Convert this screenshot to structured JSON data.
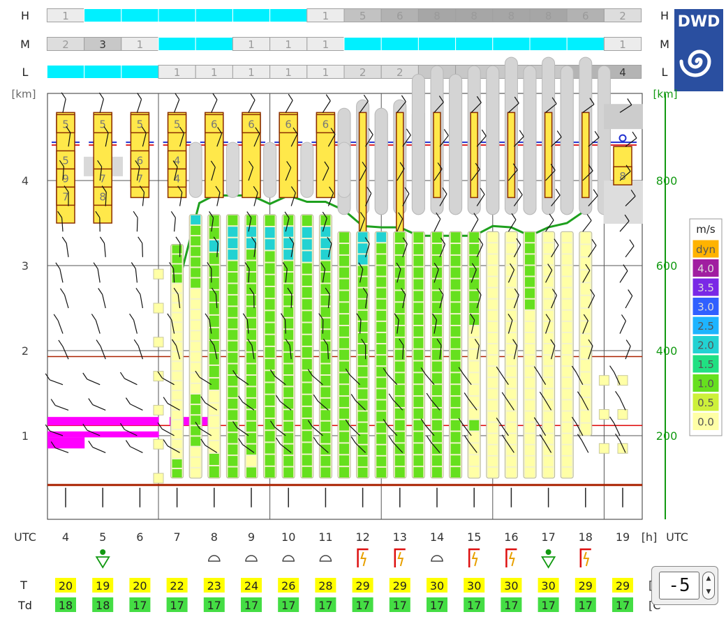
{
  "chart_data": {
    "type": "meteogram",
    "time_axis": {
      "label": "UTC",
      "unit": "[h]",
      "right_label": "UTC",
      "hours": [
        4,
        5,
        6,
        7,
        8,
        9,
        10,
        11,
        12,
        13,
        14,
        15,
        16,
        17,
        18,
        19
      ]
    },
    "left_axis": {
      "unit": "[km]",
      "ticks": [
        1,
        2,
        3,
        4
      ],
      "range": [
        0.35,
        4.95
      ]
    },
    "right_axis": {
      "unit": "[km]",
      "ticks": [
        200,
        400,
        600,
        800
      ],
      "range": [
        70,
        990
      ],
      "color": "#119911"
    },
    "cloud_layers": [
      {
        "label": "H",
        "cells": [
          {
            "hours": [
              4
            ],
            "val": "1"
          },
          {
            "hours": [
              5,
              6,
              7,
              8,
              9,
              10
            ],
            "val": "cyan"
          },
          {
            "hours": [
              11
            ],
            "val": "1"
          },
          {
            "hours": [
              12
            ],
            "val": "5"
          },
          {
            "hours": [
              13
            ],
            "val": "6"
          },
          {
            "hours": [
              14
            ],
            "val": "8"
          },
          {
            "hours": [
              15
            ],
            "val": "8"
          },
          {
            "hours": [
              16
            ],
            "val": "8"
          },
          {
            "hours": [
              17
            ],
            "val": "8"
          },
          {
            "hours": [
              18
            ],
            "val": "6"
          },
          {
            "hours": [
              19
            ],
            "val": "2"
          }
        ]
      },
      {
        "label": "M",
        "cells": [
          {
            "hours": [
              4
            ],
            "val": "2"
          },
          {
            "hours": [
              5
            ],
            "val": "3"
          },
          {
            "hours": [
              6
            ],
            "val": "1"
          },
          {
            "hours": [
              7,
              8
            ],
            "val": "cyan"
          },
          {
            "hours": [
              9
            ],
            "val": "1"
          },
          {
            "hours": [
              10
            ],
            "val": "1"
          },
          {
            "hours": [
              11
            ],
            "val": "1"
          },
          {
            "hours": [
              12,
              13,
              14,
              15,
              16,
              17,
              18
            ],
            "val": "cyan"
          },
          {
            "hours": [
              19
            ],
            "val": "1"
          }
        ]
      },
      {
        "label": "L",
        "cells": [
          {
            "hours": [
              4,
              5,
              6
            ],
            "val": "cyan"
          },
          {
            "hours": [
              7
            ],
            "val": "1"
          },
          {
            "hours": [
              8
            ],
            "val": "1"
          },
          {
            "hours": [
              9
            ],
            "val": "1"
          },
          {
            "hours": [
              10
            ],
            "val": "1"
          },
          {
            "hours": [
              11
            ],
            "val": "1"
          },
          {
            "hours": [
              12
            ],
            "val": "2"
          },
          {
            "hours": [
              13
            ],
            "val": "2"
          },
          {
            "hours": [
              14
            ],
            "val": "3"
          },
          {
            "hours": [
              15
            ],
            "val": "3"
          },
          {
            "hours": [
              16
            ],
            "val": "3"
          },
          {
            "hours": [
              17
            ],
            "val": "3"
          },
          {
            "hours": [
              18
            ],
            "val": "4"
          },
          {
            "hours": [
              19
            ],
            "val": "4"
          }
        ]
      }
    ],
    "layer_colors": {
      "cyan": "#00f0ff",
      "1": "#ececec",
      "2": "#dddddd",
      "3": "#c8c8c8",
      "4": "#b4b4b4",
      "5": "#c2c2c2",
      "6": "#b2b2b2",
      "8": "#a6a6a6",
      "text_light": "#9a9a9a",
      "text_dark": "#333333"
    },
    "logo_text": "DWD",
    "logo_color": "#2a4fa0",
    "series": [
      {
        "name": "boundary_layer_height",
        "unit": "m",
        "x": [
          7,
          7.6,
          8,
          8.5,
          9,
          9.5,
          10,
          10.5,
          11,
          11.5,
          12,
          12.5,
          13,
          13.5,
          14,
          14.5,
          15,
          15.5,
          16,
          16.5,
          17,
          17.5,
          18
        ],
        "values": [
          543,
          747,
          765,
          765,
          765,
          745,
          765,
          750,
          750,
          730,
          693,
          690,
          690,
          670,
          670,
          670,
          670,
          693,
          690,
          670,
          690,
          700,
          730
        ]
      }
    ],
    "temperature_label": "T",
    "temperature": [
      20,
      19,
      20,
      22,
      23,
      24,
      26,
      28,
      29,
      29,
      30,
      30,
      30,
      30,
      29,
      29
    ],
    "dewpoint_label": "Td",
    "dewpoint": [
      18,
      18,
      17,
      17,
      17,
      17,
      17,
      17,
      17,
      17,
      17,
      17,
      17,
      17,
      17,
      17
    ],
    "temp_unit_partial": "[C",
    "weather_symbols": [
      "",
      "drizzle-shower",
      "",
      "",
      "cloud",
      "cloud",
      "cloud",
      "cloud",
      "thunderstorm",
      "thunderstorm",
      "cloud",
      "thunderstorm",
      "thunderstorm",
      "drizzle-shower",
      "thunderstorm",
      ""
    ],
    "updraft_legend": {
      "title": "m/s",
      "entries": [
        {
          "label": "dyn",
          "color": "#ffb300"
        },
        {
          "label": "4.0",
          "color": "#a01ea0"
        },
        {
          "label": "3.5",
          "color": "#7a28e6"
        },
        {
          "label": "3.0",
          "color": "#3060ff"
        },
        {
          "label": "2.5",
          "color": "#1eb4ff"
        },
        {
          "label": "2.0",
          "color": "#22d2d2"
        },
        {
          "label": "1.5",
          "color": "#20e082"
        },
        {
          "label": "1.0",
          "color": "#66e01e"
        },
        {
          "label": "0.5",
          "color": "#cdf03a"
        },
        {
          "label": "0.0",
          "color": "#ffffa6"
        }
      ]
    },
    "updraft_columns": [
      {
        "hour": 6.5,
        "top": 3.1,
        "bottom": 0.5,
        "cells": "p",
        "sparse": true
      },
      {
        "hour": 7,
        "top": 3.25,
        "bottom": 0.5,
        "cells": "ggggppppppppppppppppppgg"
      },
      {
        "hour": 7.5,
        "top": 3.6,
        "bottom": 0.5,
        "cells": "cggggggppppppppppgggggppp"
      },
      {
        "hour": 8,
        "top": 3.6,
        "bottom": 0.5,
        "cells": "ggcgggggggggggpppppgg"
      },
      {
        "hour": 8.5,
        "top": 3.6,
        "bottom": 0.5,
        "cells": "gcccggggggggggggggggggg"
      },
      {
        "hour": 9,
        "top": 3.6,
        "bottom": 0.5,
        "cells": "gccggggggggggggggggggpg"
      },
      {
        "hour": 9.5,
        "top": 3.6,
        "bottom": 0.5,
        "cells": "gccggggggggggggggggggg"
      },
      {
        "hour": 10,
        "top": 3.6,
        "bottom": 0.5,
        "cells": "gcccggggggggggggggggggg"
      },
      {
        "hour": 10.5,
        "top": 3.6,
        "bottom": 0.5,
        "cells": "gcccgggggggggggggggggg"
      },
      {
        "hour": 11,
        "top": 3.6,
        "bottom": 0.5,
        "cells": "gcccggggggggggggggggggg"
      },
      {
        "hour": 11.5,
        "top": 3.4,
        "bottom": 0.5,
        "cells": "ggggggggggggggggggggg"
      },
      {
        "hour": 12,
        "top": 3.4,
        "bottom": 0.5,
        "cells": "cccggggggggggggggggggg"
      },
      {
        "hour": 12.5,
        "top": 3.4,
        "bottom": 0.5,
        "cells": "cggggggggggggggggggggg"
      },
      {
        "hour": 13,
        "top": 3.4,
        "bottom": 0.5,
        "cells": "ggggggggggggggggggggg"
      },
      {
        "hour": 13.5,
        "top": 3.4,
        "bottom": 0.5,
        "cells": "ggggggggggggggggggggg"
      },
      {
        "hour": 14,
        "top": 3.4,
        "bottom": 0.5,
        "cells": "ggggggggggggggggggggg"
      },
      {
        "hour": 14.5,
        "top": 3.4,
        "bottom": 0.5,
        "cells": "ggggggggggggggggggggg"
      },
      {
        "hour": 15,
        "top": 3.4,
        "bottom": 0.5,
        "cells": "ggggggggppppppppgpppp"
      },
      {
        "hour": 15.5,
        "top": 3.4,
        "bottom": 0.5,
        "cells": "pppppppppppppppppppppp"
      },
      {
        "hour": 16,
        "top": 3.4,
        "bottom": 0.5,
        "cells": "pppppppppppppppppppppp"
      },
      {
        "hour": 16.5,
        "top": 3.4,
        "bottom": 0.5,
        "cells": "gggggggppppppppppppppp"
      },
      {
        "hour": 17,
        "top": 3.4,
        "bottom": 0.5,
        "cells": "pppppppppppppppppppppp"
      },
      {
        "hour": 17.5,
        "top": 3.4,
        "bottom": 0.5,
        "cells": "pppppppppppppppppppppp"
      },
      {
        "hour": 18,
        "top": 3.4,
        "bottom": 1.0,
        "cells": "pppppppppppppppp"
      },
      {
        "hour": 18.5,
        "top": 2.05,
        "bottom": 0.85,
        "cells": "p",
        "sparse": true
      },
      {
        "hour": 19,
        "top": 2.05,
        "bottom": 0.85,
        "cells": "p",
        "sparse": true
      }
    ],
    "cloud_boxes": [
      {
        "hour": 4,
        "top": 4.8,
        "bottom": 3.5,
        "labels": [
          "5",
          "",
          "5",
          "9",
          "7"
        ]
      },
      {
        "hour": 5,
        "top": 4.8,
        "bottom": 3.5,
        "labels": [
          "5",
          "",
          "",
          "7",
          "8"
        ]
      },
      {
        "hour": 6,
        "top": 4.8,
        "bottom": 3.8,
        "labels": [
          "5",
          "",
          "6",
          "7"
        ]
      },
      {
        "hour": 7,
        "top": 4.8,
        "bottom": 3.8,
        "labels": [
          "5",
          "",
          "4",
          "4"
        ]
      },
      {
        "hour": 8,
        "top": 4.8,
        "bottom": 3.8,
        "labels": [
          "6"
        ]
      },
      {
        "hour": 9,
        "top": 4.8,
        "bottom": 3.8,
        "labels": [
          "6"
        ]
      },
      {
        "hour": 10,
        "top": 4.8,
        "bottom": 3.8,
        "labels": [
          "6"
        ]
      },
      {
        "hour": 11,
        "top": 4.8,
        "bottom": 3.8,
        "labels": [
          "6"
        ]
      },
      {
        "hour": 12,
        "top": 4.8,
        "bottom": 3.3,
        "labels": []
      },
      {
        "hour": 13,
        "top": 4.8,
        "bottom": 3.0,
        "labels": []
      },
      {
        "hour": 14,
        "top": 4.8,
        "bottom": 3.8,
        "labels": []
      },
      {
        "hour": 15,
        "top": 4.8,
        "bottom": 3.8,
        "labels": []
      },
      {
        "hour": 16,
        "top": 4.8,
        "bottom": 3.8,
        "labels": []
      },
      {
        "hour": 17,
        "top": 4.8,
        "bottom": 3.8,
        "labels": []
      },
      {
        "hour": 18,
        "top": 4.8,
        "bottom": 3.8,
        "labels": []
      },
      {
        "hour": 19,
        "top": 4.4,
        "bottom": 4.0,
        "labels": [
          "",
          "8"
        ]
      }
    ],
    "icing_bands": [
      {
        "from": 4,
        "to": 7,
        "bottom": 1.12,
        "top": 1.22,
        "color": "#ff00ff"
      },
      {
        "from": 4,
        "to": 7,
        "bottom": 0.98,
        "top": 1.05,
        "color": "#ff00ff"
      },
      {
        "from": 4,
        "to": 5,
        "bottom": 0.85,
        "top": 0.98,
        "color": "#ff00ff"
      },
      {
        "from": 7.3,
        "to": 8.5,
        "bottom": 1.12,
        "top": 1.22,
        "color": "#ff00ff"
      }
    ],
    "reference_lines": [
      {
        "y": 1.93,
        "color": "#aa2200"
      },
      {
        "y": 1.12,
        "color": "#dd0000"
      },
      {
        "y": 0.42,
        "color": "#aa2200"
      }
    ],
    "spinner_value": "-5"
  }
}
